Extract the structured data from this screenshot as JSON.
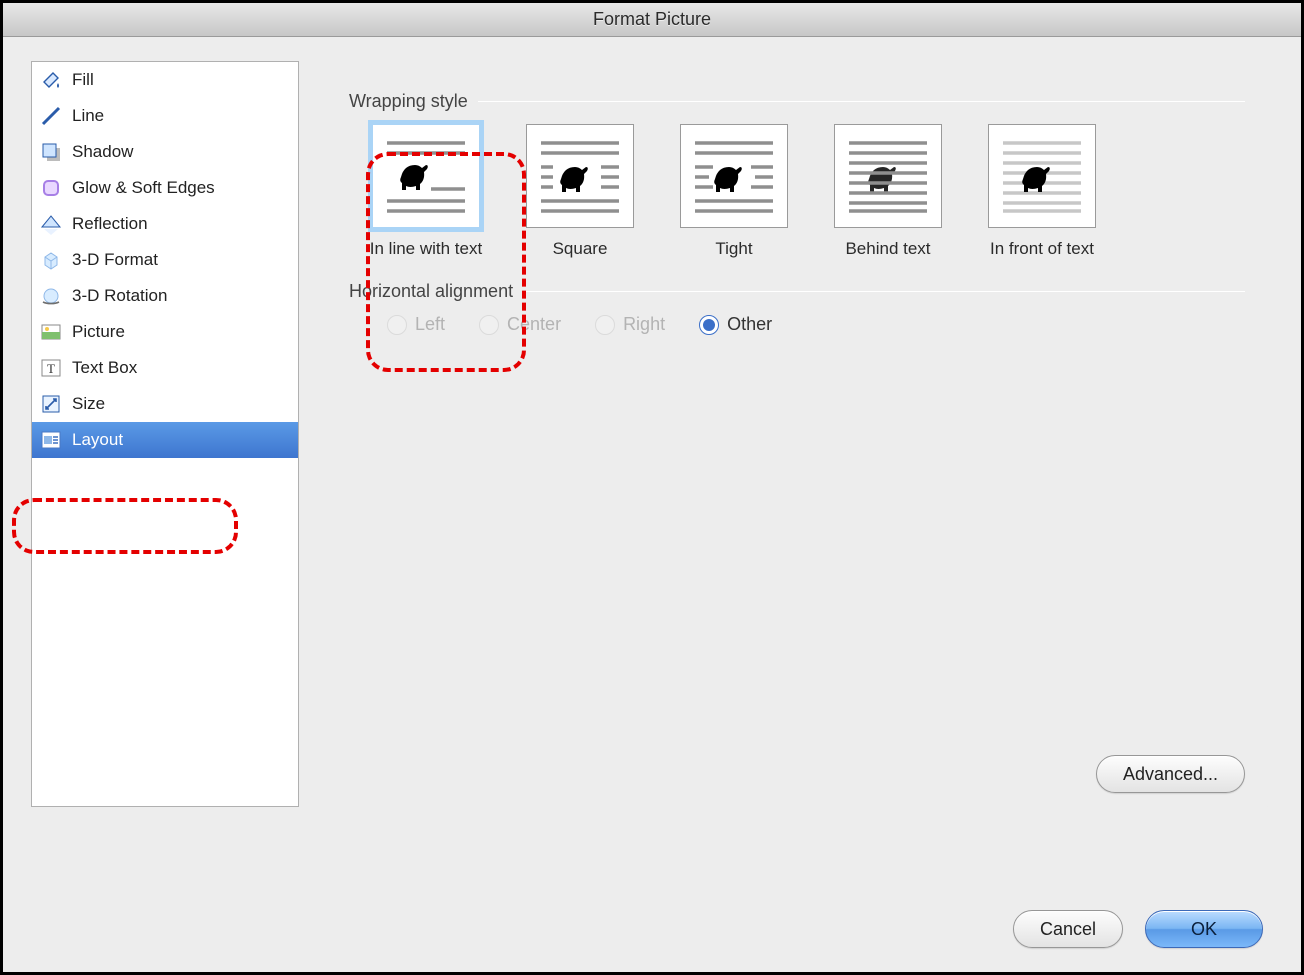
{
  "window": {
    "title": "Format Picture"
  },
  "sidebar": {
    "items": [
      {
        "label": "Fill"
      },
      {
        "label": "Line"
      },
      {
        "label": "Shadow"
      },
      {
        "label": "Glow & Soft Edges"
      },
      {
        "label": "Reflection"
      },
      {
        "label": "3-D Format"
      },
      {
        "label": "3-D Rotation"
      },
      {
        "label": "Picture"
      },
      {
        "label": "Text Box"
      },
      {
        "label": "Size"
      },
      {
        "label": "Layout"
      }
    ],
    "selected_index": 10
  },
  "main": {
    "wrapping_section_label": "Wrapping style",
    "wrapping_options": [
      {
        "label": "In line with text"
      },
      {
        "label": "Square"
      },
      {
        "label": "Tight"
      },
      {
        "label": "Behind text"
      },
      {
        "label": "In front of text"
      }
    ],
    "wrapping_selected_index": 0,
    "align_section_label": "Horizontal alignment",
    "align_options": [
      {
        "label": "Left",
        "enabled": false
      },
      {
        "label": "Center",
        "enabled": false
      },
      {
        "label": "Right",
        "enabled": false
      },
      {
        "label": "Other",
        "enabled": true
      }
    ],
    "align_selected_index": 3,
    "advanced_button": "Advanced..."
  },
  "footer": {
    "cancel": "Cancel",
    "ok": "OK"
  }
}
